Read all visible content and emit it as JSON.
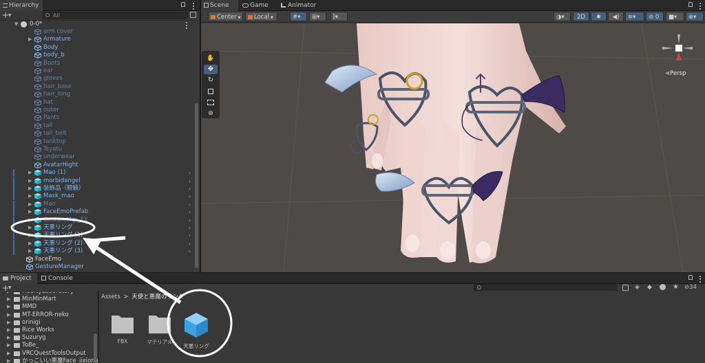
{
  "hierarchy": {
    "tab_label": "Hierarchy",
    "search_placeholder": "All",
    "scene_name": "0-0*",
    "rows": [
      {
        "label": "arm cover",
        "color": "dim",
        "indent": 2,
        "arrow": false,
        "chev": false
      },
      {
        "label": "Armature",
        "color": "blue",
        "indent": 2,
        "arrow": true,
        "chev": false
      },
      {
        "label": "Body",
        "color": "blue",
        "indent": 2,
        "arrow": false,
        "chev": false
      },
      {
        "label": "body_b",
        "color": "blue",
        "indent": 2,
        "arrow": false,
        "chev": false
      },
      {
        "label": "Boots",
        "color": "dim",
        "indent": 2,
        "arrow": false,
        "chev": false
      },
      {
        "label": "ear",
        "color": "dim",
        "indent": 2,
        "arrow": false,
        "chev": false
      },
      {
        "label": "gloves",
        "color": "dim",
        "indent": 2,
        "arrow": false,
        "chev": false
      },
      {
        "label": "hair_base",
        "color": "dim",
        "indent": 2,
        "arrow": false,
        "chev": false
      },
      {
        "label": "hair_long",
        "color": "dim",
        "indent": 2,
        "arrow": false,
        "chev": false
      },
      {
        "label": "hat",
        "color": "dim",
        "indent": 2,
        "arrow": false,
        "chev": false
      },
      {
        "label": "outer",
        "color": "dim",
        "indent": 2,
        "arrow": false,
        "chev": false
      },
      {
        "label": "Pants",
        "color": "dim",
        "indent": 2,
        "arrow": false,
        "chev": false
      },
      {
        "label": "tail",
        "color": "dim",
        "indent": 2,
        "arrow": false,
        "chev": false
      },
      {
        "label": "tail_belt",
        "color": "dim",
        "indent": 2,
        "arrow": false,
        "chev": false
      },
      {
        "label": "tanktop",
        "color": "dim",
        "indent": 2,
        "arrow": false,
        "chev": false
      },
      {
        "label": "Tsyatu",
        "color": "dim",
        "indent": 2,
        "arrow": false,
        "chev": false
      },
      {
        "label": "underwear",
        "color": "dim",
        "indent": 2,
        "arrow": false,
        "chev": false
      },
      {
        "label": "AvatarHight",
        "color": "blue",
        "indent": 2,
        "arrow": false,
        "chev": false
      },
      {
        "label": "Mao (1)",
        "color": "blue",
        "indent": 1,
        "arrow": true,
        "chev": true
      },
      {
        "label": "morbidangel",
        "color": "blue",
        "indent": 1,
        "arrow": true,
        "chev": true
      },
      {
        "label": "装飾品（眼鏡）",
        "color": "blue",
        "indent": 1,
        "arrow": true,
        "chev": true
      },
      {
        "label": "Mask_mao",
        "color": "blue",
        "indent": 1,
        "arrow": true,
        "chev": true
      },
      {
        "label": "Mao",
        "color": "dim",
        "indent": 1,
        "arrow": true,
        "chev": true
      },
      {
        "label": "FaceEmoPrefab",
        "color": "blue",
        "indent": 1,
        "arrow": true,
        "chev": true
      },
      {
        "label": "GestureMgr_FX",
        "color": "dim",
        "indent": 1,
        "arrow": true,
        "chev": true
      },
      {
        "label": "天悪リング",
        "color": "blue",
        "indent": 1,
        "arrow": true,
        "chev": true
      },
      {
        "label": "天悪リング (1)",
        "color": "blue",
        "indent": 1,
        "arrow": true,
        "chev": true
      },
      {
        "label": "天悪リング (2)",
        "color": "blue",
        "indent": 1,
        "arrow": true,
        "chev": true
      },
      {
        "label": "天悪リング (3)",
        "color": "blue",
        "indent": 1,
        "arrow": true,
        "chev": true
      },
      {
        "label": "FaceEmo",
        "color": "white",
        "indent": 0,
        "arrow": false,
        "chev": false
      },
      {
        "label": "GestureManager",
        "color": "blue",
        "indent": 0,
        "arrow": false,
        "chev": false
      }
    ]
  },
  "scene": {
    "tabs": [
      "Scene",
      "Game",
      "Animator"
    ],
    "active_tab": "Scene",
    "pivot_label": "Center",
    "space_label": "Local",
    "mode_2d_label": "2D",
    "gizmo_label": "Persp"
  },
  "project": {
    "tabs": [
      "Project",
      "Console"
    ],
    "search_count": "34",
    "breadcrumb_root": "Assets",
    "breadcrumb_sep": ">",
    "breadcrumb_folder": "天使と悪魔のリング",
    "tree": [
      "HeartyLaboratory",
      "MinMinMart",
      "MMD",
      "MT-ERROR-neko",
      "orinigi",
      "Rice Works",
      "Suzuryg",
      "ToBe_",
      "VRCQuestToolsOutput",
      "かっこいい悪魔Face_jixiona"
    ],
    "assets": [
      {
        "label": "FBX",
        "kind": "folder"
      },
      {
        "label": "マテリアル",
        "kind": "folder"
      },
      {
        "label": "天悪リング",
        "kind": "prefab"
      }
    ]
  },
  "colors": {
    "accent": "#46607c",
    "prefab_blue": "#7cb6f0",
    "annotation": "#ffffff"
  }
}
